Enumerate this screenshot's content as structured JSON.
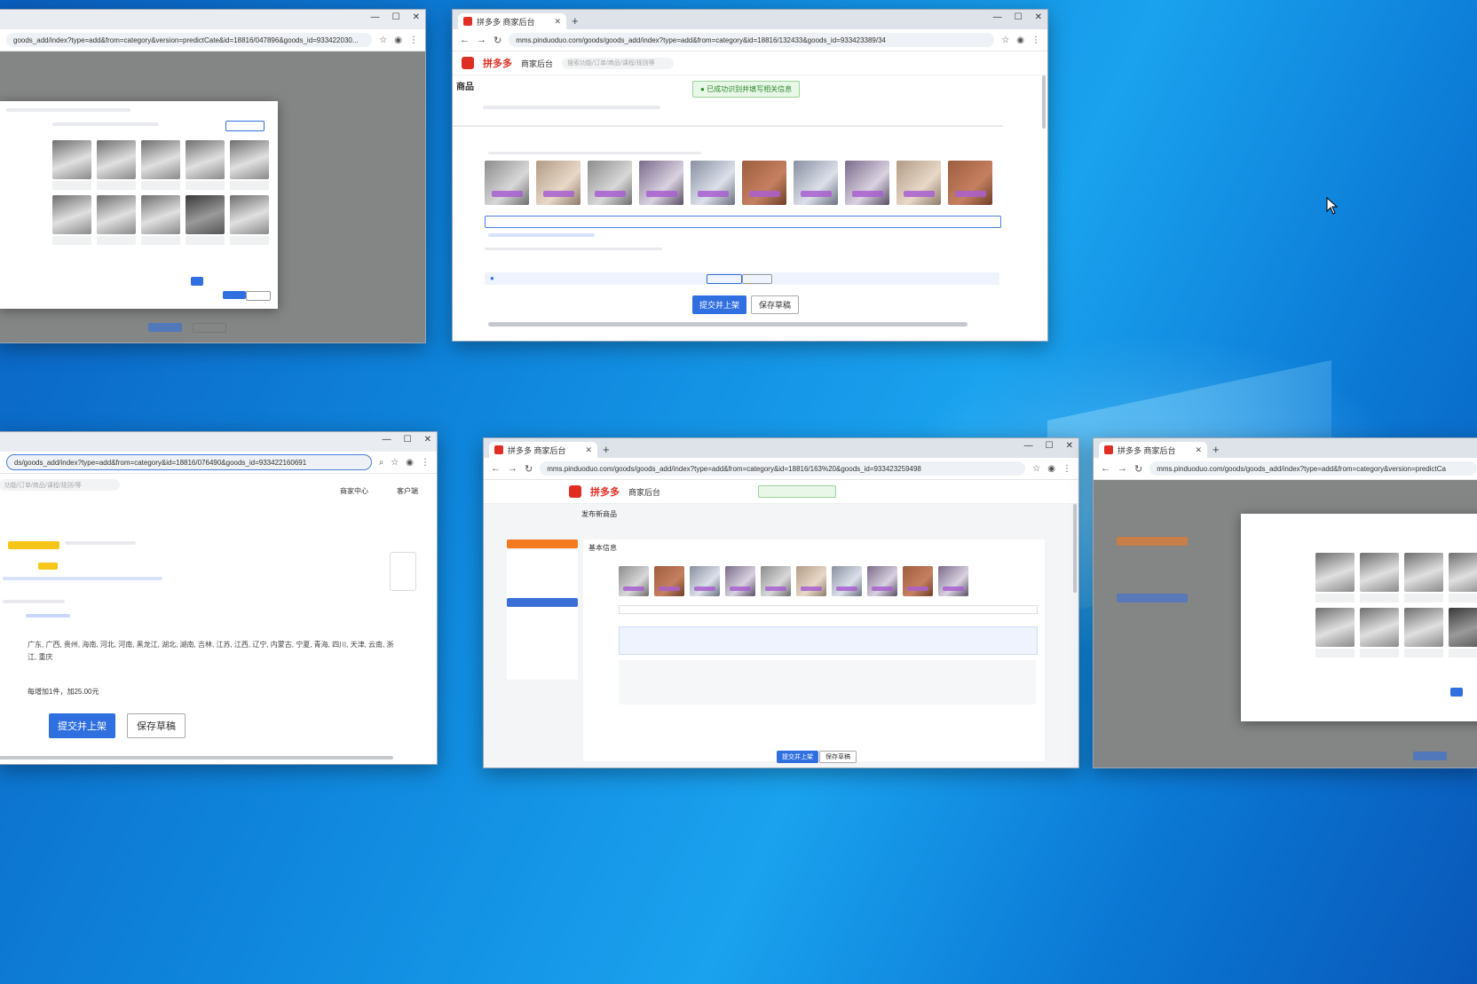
{
  "tab_title": "拼多多 商家后台",
  "win_top_center": {
    "url": "mms.pinduoduo.com/goods/goods_add/index?type=add&from=category&id=18816/132433&goods_id=933423389/34",
    "logo": "拼多多",
    "logo_sub": "商家后台",
    "search_placeholder": "搜索功能/订单/商品/课程/规则等",
    "page_title": "商品",
    "toast": "已成功识别并填写相关信息",
    "btn_submit": "提交并上架",
    "btn_save": "保存草稿"
  },
  "win_top_left": {
    "url": "goods_add/index?type=add&from=category&version=predictCate&id=18816/047896&goods_id=933422030..."
  },
  "win_bottom_left": {
    "url": "ds/goods_add/index?type=add&from=category&id=18816/076490&goods_id=933422160691",
    "search_placeholder": "功能/订单/商品/课程/规则/等",
    "region_list": "广东, 广西, 贵州, 海南, 河北, 河南, 黑龙江, 湖北, 湖南, 吉林, 江苏, 江西, 辽宁, 内蒙古, 宁夏, 青海, 四川, 天津, 云南, 浙江, 重庆",
    "shipping_note": "每增加1件，加25.00元",
    "btn_submit": "提交并上架",
    "btn_save": "保存草稿",
    "top_right_1": "商家中心",
    "top_right_2": "客户端"
  },
  "win_bottom_mid": {
    "url": "mms.pinduoduo.com/goods/goods_add/index?type=add&from=category&id=18816/163%20&goods_id=933423259498",
    "logo": "拼多多",
    "logo_sub": "商家后台",
    "page_title": "发布新商品",
    "section": "基本信息",
    "btn_submit": "提交并上架",
    "btn_save": "保存草稿"
  },
  "win_bottom_right": {
    "url": "mms.pinduoduo.com/goods/goods_add/index?type=add&from=category&version=predictCa"
  },
  "colors": {
    "pdd_red": "#e02e24",
    "primary_blue": "#2f6fe0",
    "desktop_blue": "#0f86dc"
  }
}
